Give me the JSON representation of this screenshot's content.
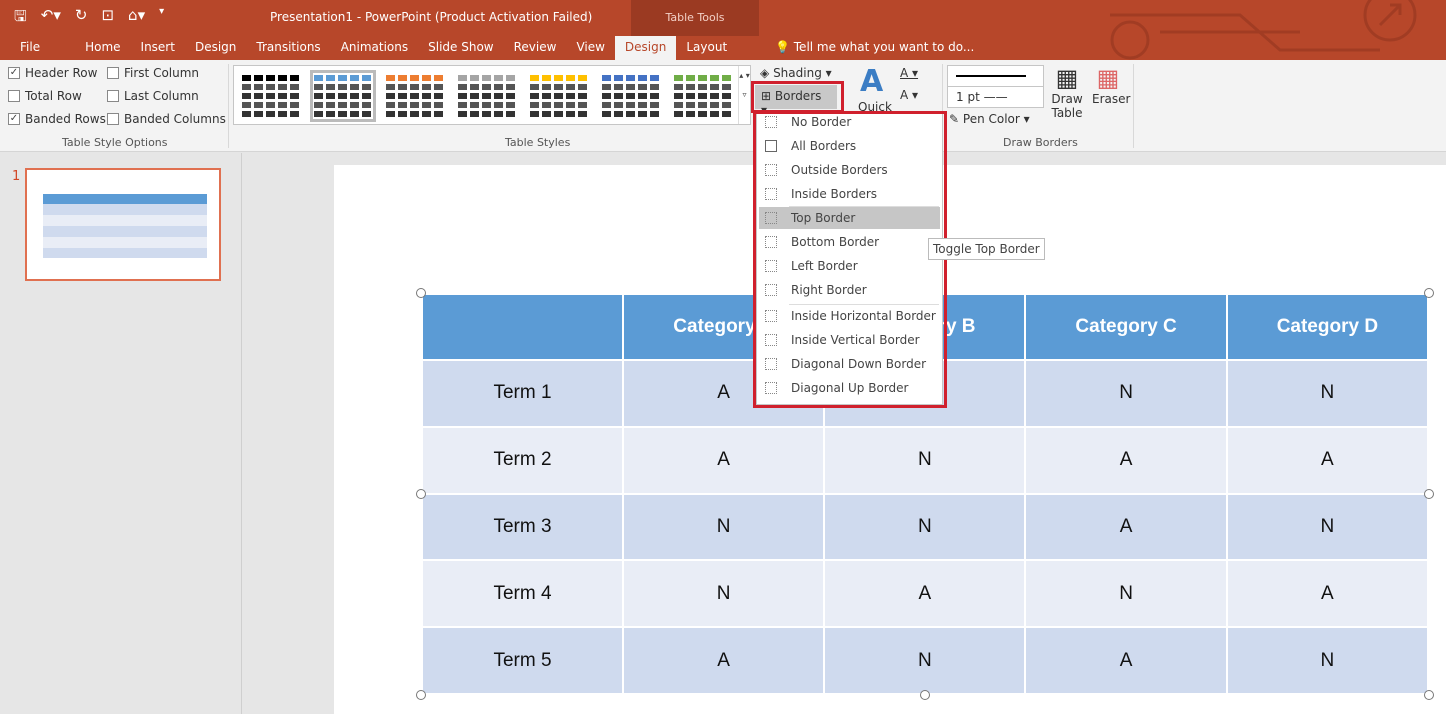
{
  "window": {
    "title": "Presentation1 - PowerPoint (Product Activation Failed)",
    "context_tab_group": "Table Tools"
  },
  "qat": {
    "icons": [
      "save-icon",
      "undo-icon",
      "redo-icon",
      "present-icon",
      "format-painter-icon",
      "customize-icon"
    ]
  },
  "tabs": [
    "File",
    "Home",
    "Insert",
    "Design",
    "Transitions",
    "Animations",
    "Slide Show",
    "Review",
    "View",
    "Design",
    "Layout"
  ],
  "active_tab": "Design",
  "tell_me": "Tell me what you want to do...",
  "style_options": {
    "group_label": "Table Style Options",
    "items": [
      {
        "label": "Header Row",
        "checked": true
      },
      {
        "label": "First Column",
        "checked": false
      },
      {
        "label": "Total Row",
        "checked": false
      },
      {
        "label": "Last Column",
        "checked": false
      },
      {
        "label": "Banded Rows",
        "checked": true
      },
      {
        "label": "Banded Columns",
        "checked": false
      }
    ]
  },
  "table_styles": {
    "group_label": "Table Styles",
    "swatches": [
      "#000000",
      "#5b9bd5",
      "#ed7d31",
      "#a5a5a5",
      "#ffc000",
      "#4472c4",
      "#70ad47"
    ],
    "selected": 1
  },
  "shading_label": "Shading",
  "borders_label": "Borders",
  "quick_label": "Quick",
  "draw_borders": {
    "group_label": "Draw Borders",
    "weight": "1 pt",
    "pen_color": "Pen Color",
    "draw_table": "Draw Table",
    "eraser": "Eraser"
  },
  "borders_menu": [
    "No Border",
    "All Borders",
    "Outside Borders",
    "Inside Borders",
    "Top Border",
    "Bottom Border",
    "Left Border",
    "Right Border",
    "Inside Horizontal Border",
    "Inside Vertical Border",
    "Diagonal Down Border",
    "Diagonal Up Border"
  ],
  "highlighted_item": "Top Border",
  "tooltip": "Toggle Top Border",
  "slide_number": "1",
  "table": {
    "headers": [
      "",
      "Category A",
      "Category B",
      "Category C",
      "Category D"
    ],
    "rows": [
      [
        "Term 1",
        "A",
        "",
        "N",
        "N"
      ],
      [
        "Term 2",
        "A",
        "N",
        "A",
        "A"
      ],
      [
        "Term 3",
        "N",
        "N",
        "A",
        "N"
      ],
      [
        "Term 4",
        "N",
        "A",
        "N",
        "A"
      ],
      [
        "Term 5",
        "A",
        "N",
        "A",
        "N"
      ]
    ]
  },
  "colors": {
    "accent": "#b7472a",
    "header": "#5b9bd5",
    "band1": "#cfdaee",
    "band2": "#e9edf6",
    "highlight_box": "#d0202d"
  }
}
